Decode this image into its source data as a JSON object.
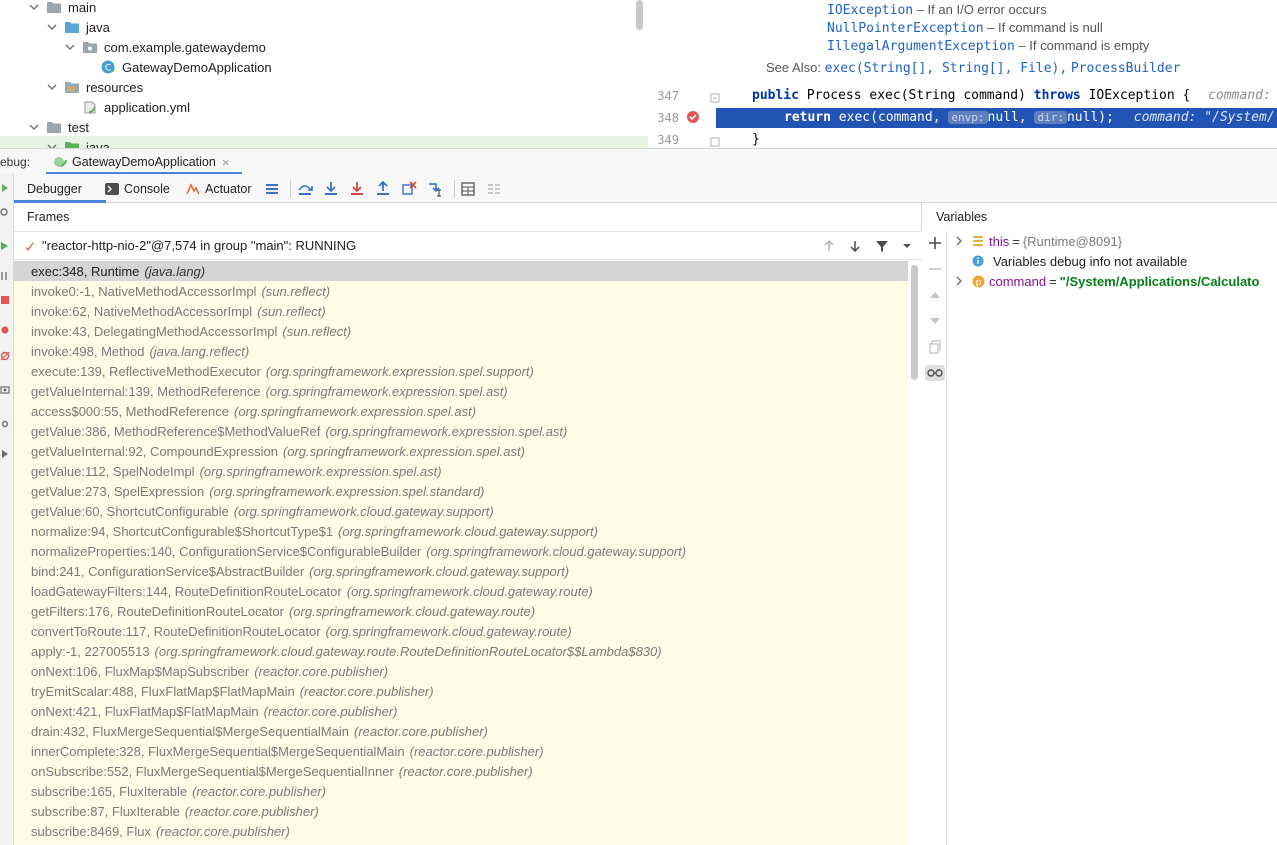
{
  "project_tree": {
    "items": [
      {
        "label": "main",
        "level": 1,
        "kind": "folder",
        "expanded": true
      },
      {
        "label": "java",
        "level": 2,
        "kind": "source-folder",
        "expanded": true
      },
      {
        "label": "com.example.gatewaydemo",
        "level": 3,
        "kind": "package",
        "expanded": true
      },
      {
        "label": "GatewayDemoApplication",
        "level": 4,
        "kind": "spring-class"
      },
      {
        "label": "resources",
        "level": 2,
        "kind": "resources-folder",
        "expanded": true
      },
      {
        "label": "application.yml",
        "level": 3,
        "kind": "yaml-file"
      },
      {
        "label": "test",
        "level": 1,
        "kind": "folder",
        "expanded": true
      },
      {
        "label": "java",
        "level": 2,
        "kind": "source-folder",
        "expanded": true
      }
    ]
  },
  "editor": {
    "doc": {
      "throws": [
        {
          "exception": "IOException",
          "desc": "– If an I/O error occurs"
        },
        {
          "exception": "NullPointerException",
          "desc": "– If command is null"
        },
        {
          "exception": "IllegalArgumentException",
          "desc": "– If command is empty"
        }
      ],
      "see_also_label": "See Also:",
      "see_also_link1": "exec(String[], String[], File)",
      "see_also_sep": ",",
      "see_also_link2": "ProcessBuilder"
    },
    "lines": [
      {
        "num": "347",
        "kw1": "public",
        "text1": " Process exec(String command) ",
        "kw2": "throws",
        "text2": " IOException {",
        "hint": "command:"
      },
      {
        "num": "348",
        "kw1": "return",
        "text1": " exec(command, ",
        "inlay1": "envp:",
        "text2": "null, ",
        "inlay2": "dir:",
        "text3": "null);",
        "hint": "command: \"/System/"
      },
      {
        "num": "349",
        "text1": "}"
      }
    ]
  },
  "debug": {
    "label": "ebug:",
    "session_tab": "GatewayDemoApplication",
    "tabs": {
      "debugger": "Debugger",
      "console": "Console",
      "actuator": "Actuator"
    }
  },
  "frames": {
    "title": "Frames",
    "thread": "\"reactor-http-nio-2\"@7,574 in group \"main\": RUNNING",
    "items": [
      {
        "method": "exec:348, Runtime",
        "pkg": "(java.lang)",
        "selected": true
      },
      {
        "method": "invoke0:-1, NativeMethodAccessorImpl",
        "pkg": "(sun.reflect)"
      },
      {
        "method": "invoke:62, NativeMethodAccessorImpl",
        "pkg": "(sun.reflect)"
      },
      {
        "method": "invoke:43, DelegatingMethodAccessorImpl",
        "pkg": "(sun.reflect)"
      },
      {
        "method": "invoke:498, Method",
        "pkg": "(java.lang.reflect)"
      },
      {
        "method": "execute:139, ReflectiveMethodExecutor",
        "pkg": "(org.springframework.expression.spel.support)"
      },
      {
        "method": "getValueInternal:139, MethodReference",
        "pkg": "(org.springframework.expression.spel.ast)"
      },
      {
        "method": "access$000:55, MethodReference",
        "pkg": "(org.springframework.expression.spel.ast)"
      },
      {
        "method": "getValue:386, MethodReference$MethodValueRef",
        "pkg": "(org.springframework.expression.spel.ast)"
      },
      {
        "method": "getValueInternal:92, CompoundExpression",
        "pkg": "(org.springframework.expression.spel.ast)"
      },
      {
        "method": "getValue:112, SpelNodeImpl",
        "pkg": "(org.springframework.expression.spel.ast)"
      },
      {
        "method": "getValue:273, SpelExpression",
        "pkg": "(org.springframework.expression.spel.standard)"
      },
      {
        "method": "getValue:60, ShortcutConfigurable",
        "pkg": "(org.springframework.cloud.gateway.support)"
      },
      {
        "method": "normalize:94, ShortcutConfigurable$ShortcutType$1",
        "pkg": "(org.springframework.cloud.gateway.support)"
      },
      {
        "method": "normalizeProperties:140, ConfigurationService$ConfigurableBuilder",
        "pkg": "(org.springframework.cloud.gateway.support)"
      },
      {
        "method": "bind:241, ConfigurationService$AbstractBuilder",
        "pkg": "(org.springframework.cloud.gateway.support)"
      },
      {
        "method": "loadGatewayFilters:144, RouteDefinitionRouteLocator",
        "pkg": "(org.springframework.cloud.gateway.route)"
      },
      {
        "method": "getFilters:176, RouteDefinitionRouteLocator",
        "pkg": "(org.springframework.cloud.gateway.route)"
      },
      {
        "method": "convertToRoute:117, RouteDefinitionRouteLocator",
        "pkg": "(org.springframework.cloud.gateway.route)"
      },
      {
        "method": "apply:-1, 227005513",
        "pkg": "(org.springframework.cloud.gateway.route.RouteDefinitionRouteLocator$$Lambda$830)"
      },
      {
        "method": "onNext:106, FluxMap$MapSubscriber",
        "pkg": "(reactor.core.publisher)"
      },
      {
        "method": "tryEmitScalar:488, FluxFlatMap$FlatMapMain",
        "pkg": "(reactor.core.publisher)"
      },
      {
        "method": "onNext:421, FluxFlatMap$FlatMapMain",
        "pkg": "(reactor.core.publisher)"
      },
      {
        "method": "drain:432, FluxMergeSequential$MergeSequentialMain",
        "pkg": "(reactor.core.publisher)"
      },
      {
        "method": "innerComplete:328, FluxMergeSequential$MergeSequentialMain",
        "pkg": "(reactor.core.publisher)"
      },
      {
        "method": "onSubscribe:552, FluxMergeSequential$MergeSequentialInner",
        "pkg": "(reactor.core.publisher)"
      },
      {
        "method": "subscribe:165, FluxIterable",
        "pkg": "(reactor.core.publisher)"
      },
      {
        "method": "subscribe:87, FluxIterable",
        "pkg": "(reactor.core.publisher)"
      },
      {
        "method": "subscribe:8469, Flux",
        "pkg": "(reactor.core.publisher)"
      }
    ]
  },
  "variables": {
    "title": "Variables",
    "items": [
      {
        "name": "this",
        "eq": "=",
        "value": "{Runtime@8091}",
        "kind": "object",
        "expandable": true
      },
      {
        "info": "Variables debug info not available",
        "kind": "info"
      },
      {
        "name": "command",
        "eq": "=",
        "value": "\"/System/Applications/Calculato",
        "kind": "param",
        "expandable": true
      }
    ]
  },
  "colors": {
    "accent": "#4a83d8",
    "exec_line": "#2154b4",
    "frames_bg": "#fdfde6",
    "string_value": "#067d17",
    "var_name": "#871094"
  }
}
